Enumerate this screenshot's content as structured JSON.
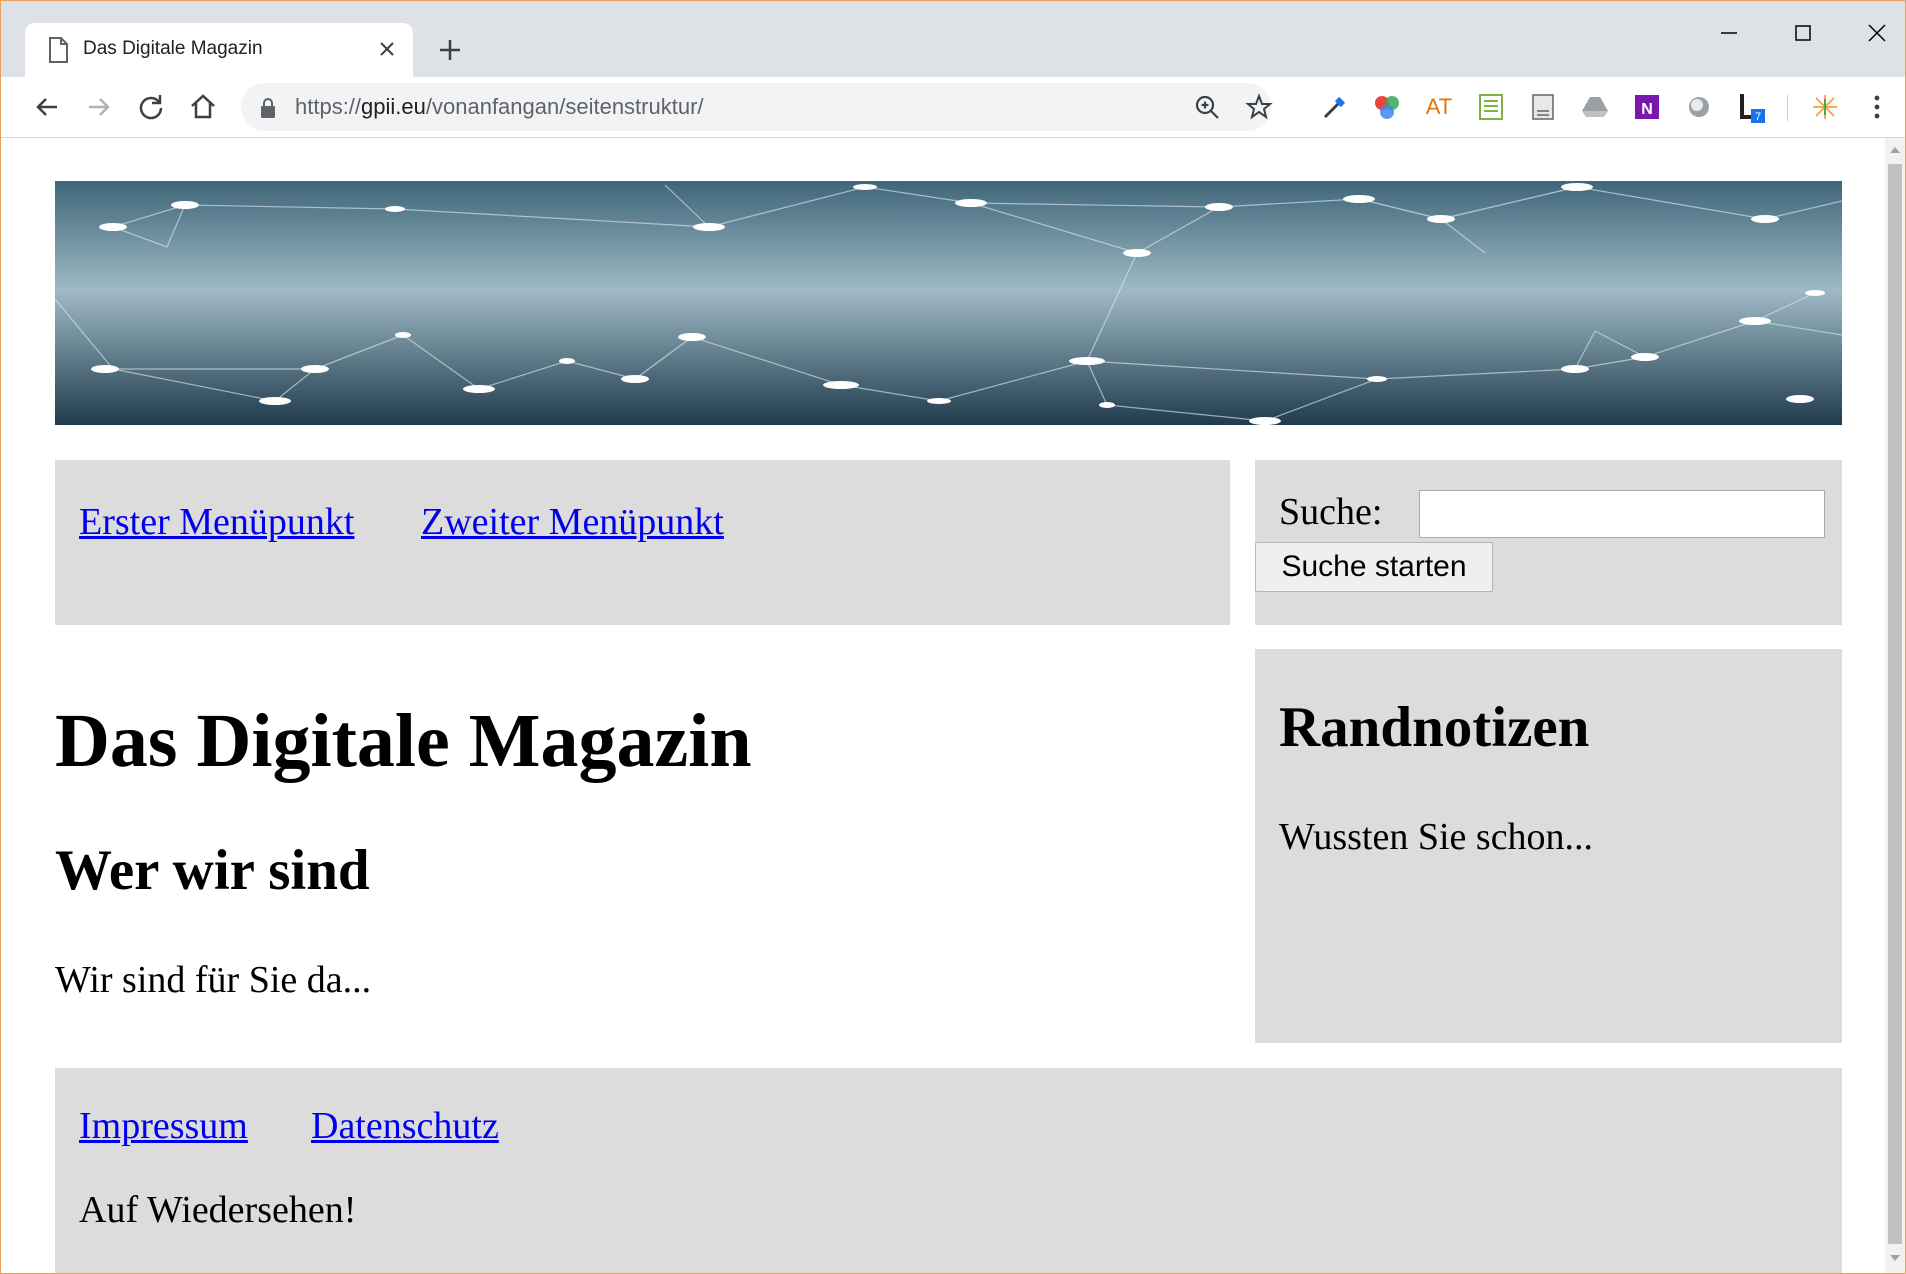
{
  "browser": {
    "tab_title": "Das Digitale Magazin",
    "url_scheme": "https://",
    "url_domain": "gpii.eu",
    "url_path": "/vonanfangan/seitenstruktur/",
    "extensions": [
      {
        "name": "eyedropper-icon"
      },
      {
        "name": "color-wheel-icon"
      },
      {
        "name": "at-icon",
        "label": "AT"
      },
      {
        "name": "spreadsheet-icon"
      },
      {
        "name": "document-icon"
      },
      {
        "name": "drive-icon"
      },
      {
        "name": "onenote-icon",
        "label": "N"
      },
      {
        "name": "circle-icon"
      },
      {
        "name": "lighthouse-icon",
        "label": "L",
        "badge": "7"
      },
      {
        "name": "sparkle-icon"
      }
    ]
  },
  "header": {
    "nav": [
      "Erster Menüpunkt",
      "Zweiter Menüpunkt"
    ]
  },
  "search": {
    "label": "Suche:",
    "value": "",
    "button": "Suche starten"
  },
  "main": {
    "h1": "Das Digitale Magazin",
    "h2": "Wer wir sind",
    "text": "Wir sind für Sie da..."
  },
  "aside": {
    "title": "Randnotizen",
    "text": "Wussten Sie schon..."
  },
  "footer": {
    "links": [
      "Impressum",
      "Datenschutz"
    ],
    "text": "Auf Wiedersehen!"
  },
  "colors": {
    "tabstrip": "#dee1e6",
    "box": "#dcdcdc",
    "link": "#0000ee",
    "banner_dark": "#2f5366",
    "banner_light": "#9fbac5"
  }
}
